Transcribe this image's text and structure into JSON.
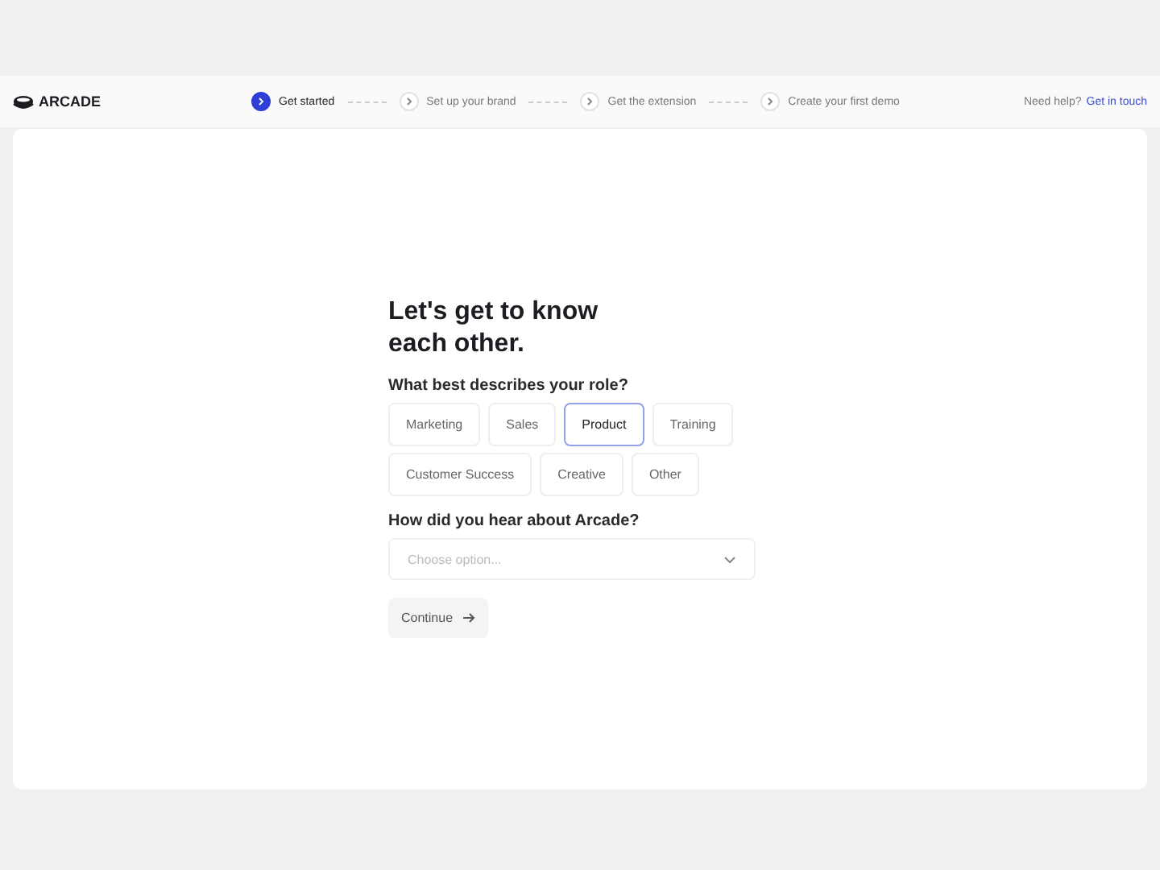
{
  "brand": {
    "name": "ARCADE"
  },
  "steps": [
    {
      "label": "Get started",
      "selected": true
    },
    {
      "label": "Set up your brand",
      "selected": false
    },
    {
      "label": "Get the extension",
      "selected": false
    },
    {
      "label": "Create your first demo",
      "selected": false
    }
  ],
  "help": {
    "text": "Need help?",
    "link": "Get in touch"
  },
  "form": {
    "title": "Let's get to know each other.",
    "role_question": "What best describes your role?",
    "roles": [
      {
        "label": "Marketing",
        "selected": false
      },
      {
        "label": "Sales",
        "selected": false
      },
      {
        "label": "Product",
        "selected": true
      },
      {
        "label": "Training",
        "selected": false
      },
      {
        "label": "Customer Success",
        "selected": false
      },
      {
        "label": "Creative",
        "selected": false
      },
      {
        "label": "Other",
        "selected": false
      }
    ],
    "source_question": "How did you hear about Arcade?",
    "source_select": {
      "placeholder": "Choose option..."
    },
    "continue_button": "Continue"
  }
}
